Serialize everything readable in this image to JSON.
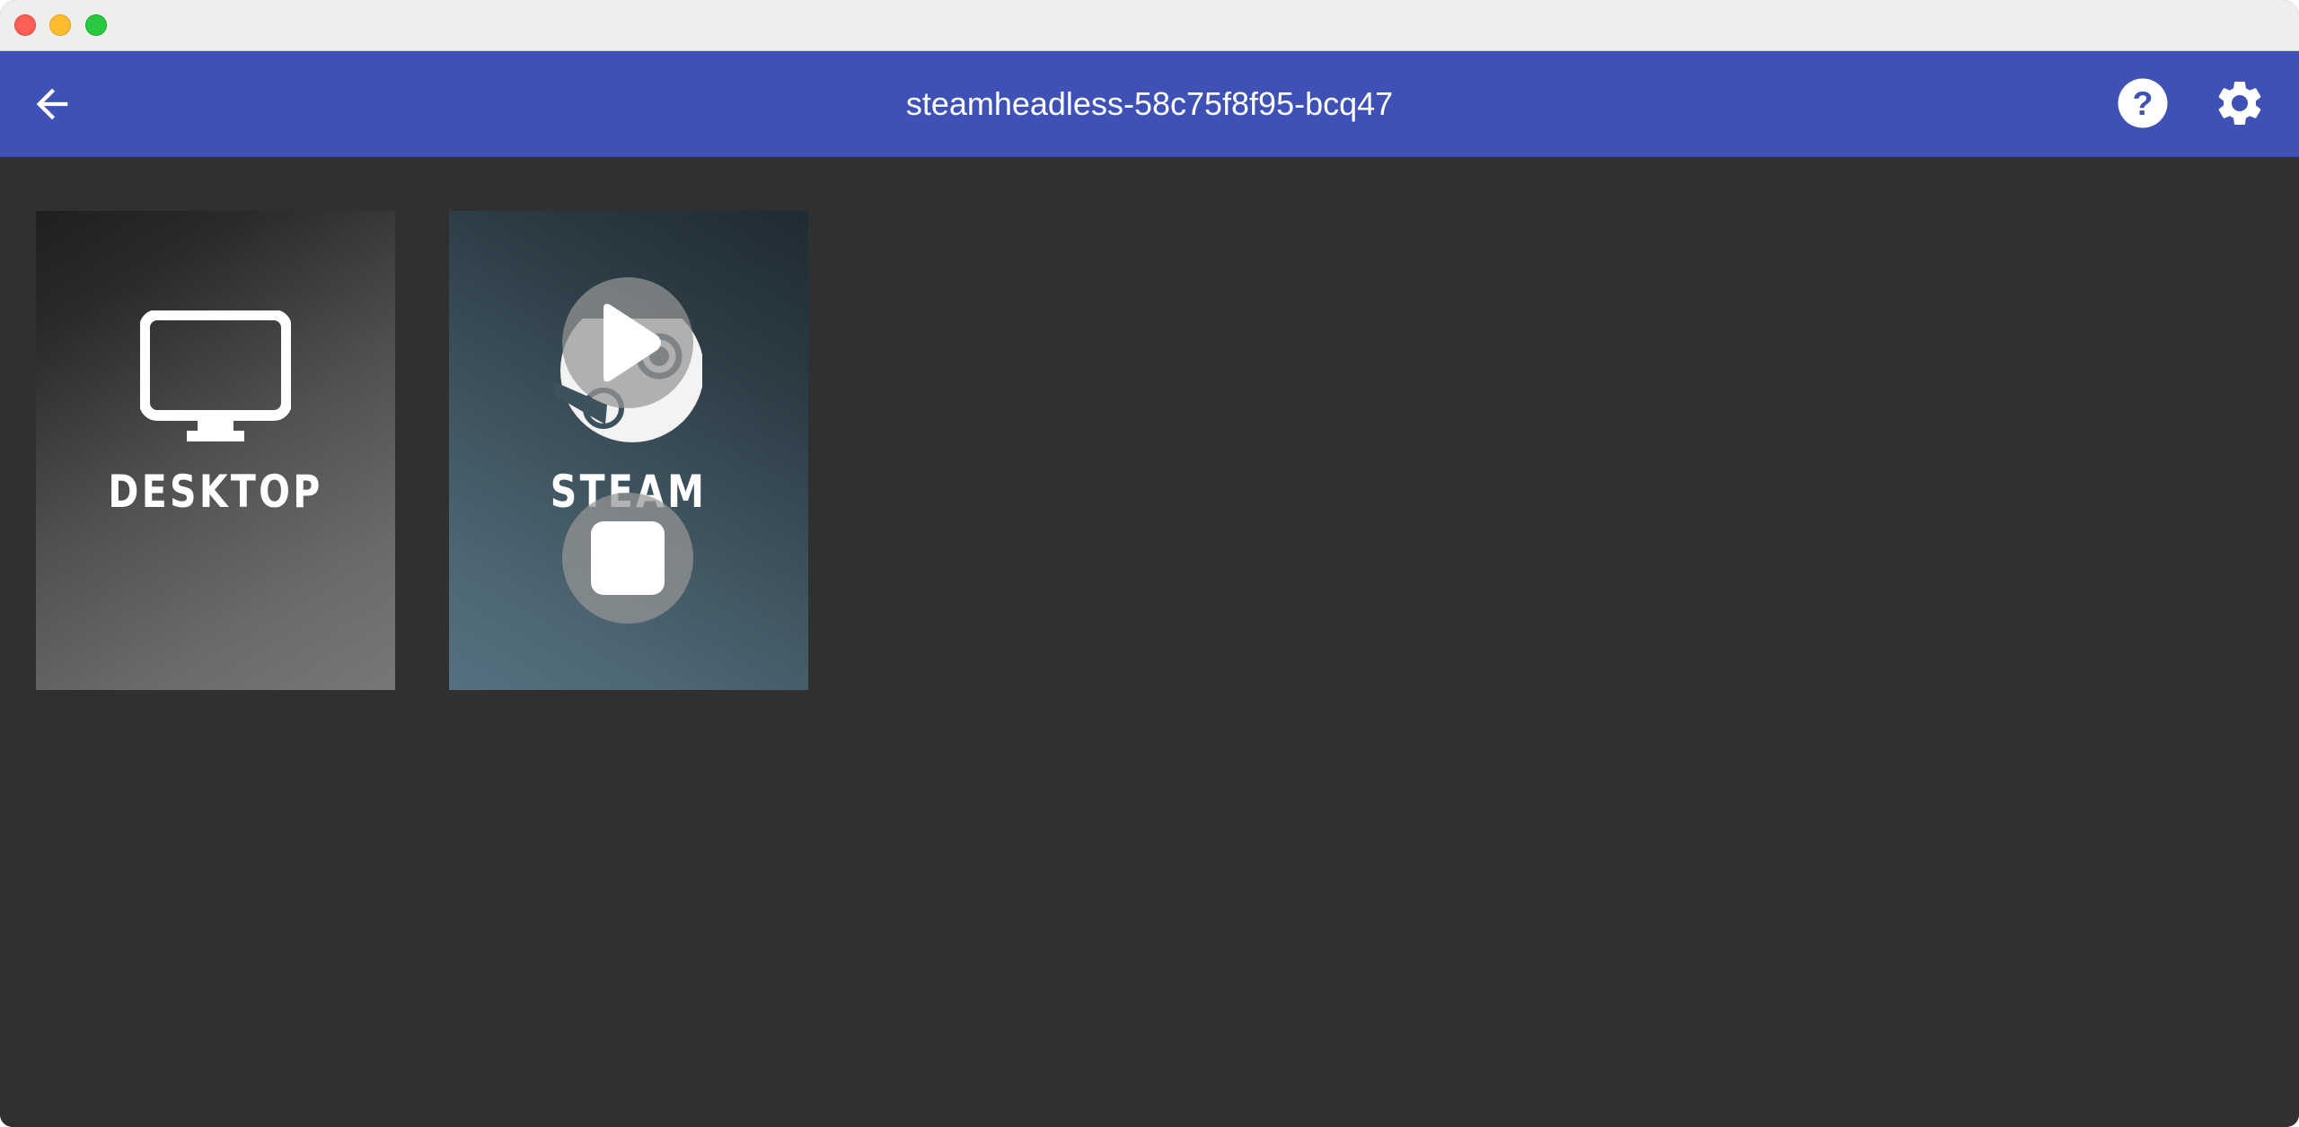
{
  "window": {
    "traffic_lights": [
      "close",
      "minimize",
      "zoom"
    ]
  },
  "appbar": {
    "title": "steamheadless-58c75f8f95-bcq47",
    "back_icon": "arrow-back-icon",
    "help_icon": "help-circle-icon",
    "settings_icon": "gear-icon",
    "color": "#3f51b5"
  },
  "apps": [
    {
      "label": "DESKTOP",
      "icon": "monitor-icon"
    },
    {
      "label": "STEAM",
      "icon": "steam-logo-icon",
      "actions": [
        "play",
        "stop"
      ]
    }
  ],
  "colors": {
    "background": "#303030",
    "accent": "#3f51b5"
  }
}
